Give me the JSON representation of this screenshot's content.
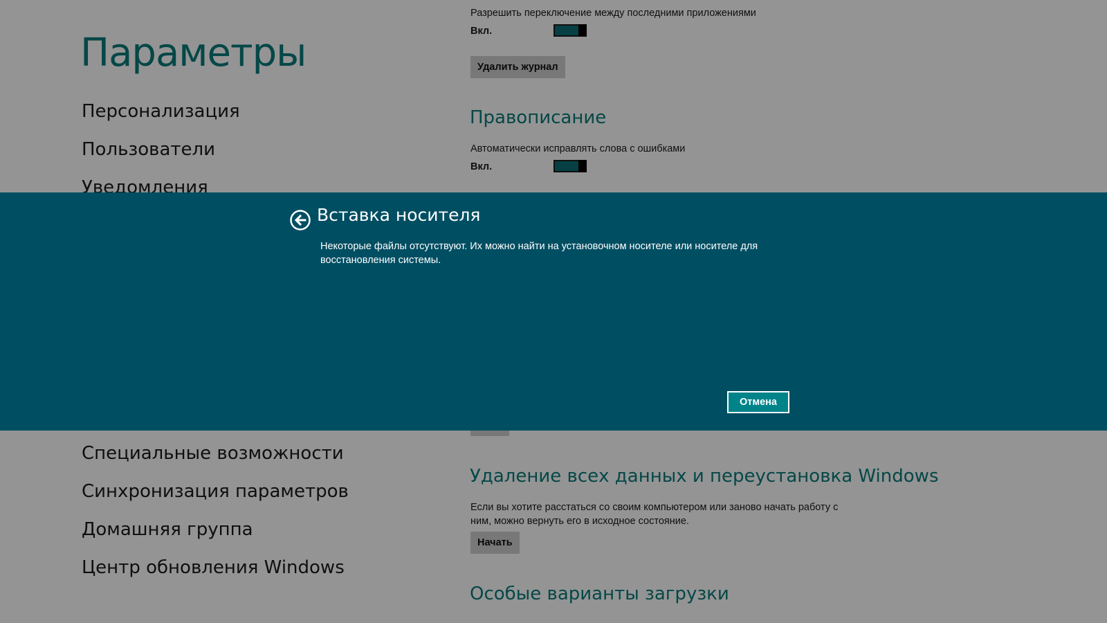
{
  "page": {
    "title": "Параметры"
  },
  "sidebar": {
    "items_top": [
      {
        "label": "Персонализация"
      },
      {
        "label": "Пользователи"
      },
      {
        "label": "Уведомления"
      }
    ],
    "items_bottom": [
      {
        "label": "Специальные возможности"
      },
      {
        "label": "Синхронизация параметров"
      },
      {
        "label": "Домашняя группа"
      },
      {
        "label": "Центр обновления Windows"
      }
    ]
  },
  "settings": {
    "app_switching": {
      "label": "Разрешить переключение между последними приложениями",
      "state": "Вкл.",
      "on": true
    },
    "clear_history_button": "Удалить журнал",
    "spelling": {
      "heading": "Правописание",
      "autocorrect": {
        "label": "Автоматически исправлять слова с ошибками",
        "state": "Вкл.",
        "on": true
      }
    },
    "reset": {
      "heading": "Удаление всех данных и переустановка Windows",
      "description": "Если вы хотите расстаться со своим компьютером или заново начать работу с ним, можно вернуть его в исходное состояние.",
      "button": "Начать"
    },
    "advanced_startup": {
      "heading": "Особые варианты загрузки"
    }
  },
  "dialog": {
    "title": "Вставка носителя",
    "message": "Некоторые файлы отсутствуют. Их можно найти на установочном носителе или носителе для восстановления системы.",
    "cancel_button": "Отмена",
    "back_icon": "back-arrow-icon"
  },
  "colors": {
    "accent": "#0b7a7a",
    "dialog_background": "#004e62",
    "cancel_button": "#00848a",
    "toggle_on": "#0d6f76"
  }
}
